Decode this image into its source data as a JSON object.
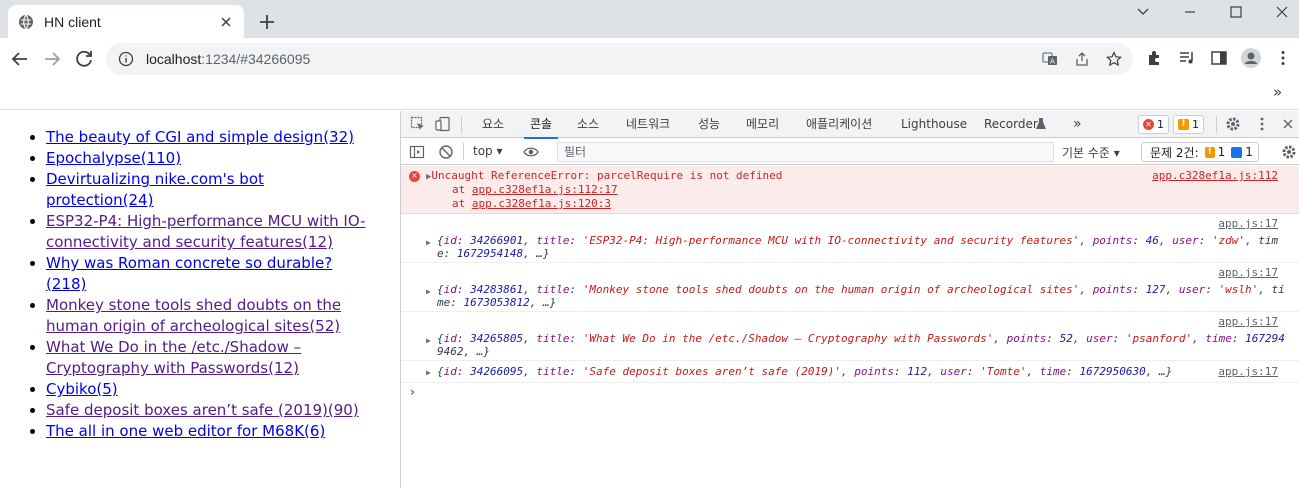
{
  "browser": {
    "tab_title": "HN client",
    "url_host": "localhost",
    "url_rest": ":1234/#34266095",
    "bookmark_more": "»"
  },
  "page": {
    "stories": [
      {
        "title": "The beauty of CGI and simple design",
        "count": "(32)",
        "visited": false
      },
      {
        "title": "Epochalypse",
        "count": "(110)",
        "visited": false
      },
      {
        "title": "Devirtualizing nike.com's bot protection",
        "count": "(24)",
        "visited": false
      },
      {
        "title": "ESP32-P4: High-performance MCU with IO-connectivity and security features",
        "count": "(12)",
        "visited": true
      },
      {
        "title": "Why was Roman concrete so durable?",
        "count": "(218)",
        "visited": false
      },
      {
        "title": "Monkey stone tools shed doubts on the human origin of archeological sites",
        "count": "(52)",
        "visited": true
      },
      {
        "title": "What We Do in the /etc./Shadow – Cryptography with Passwords",
        "count": "(12)",
        "visited": true
      },
      {
        "title": "Cybiko",
        "count": "(5)",
        "visited": false
      },
      {
        "title": "Safe deposit boxes aren’t safe (2019)",
        "count": "(90)",
        "visited": true
      },
      {
        "title": "The all in one web editor for M68K",
        "count": "(6)",
        "visited": false
      }
    ]
  },
  "devtools": {
    "tabs": [
      "요소",
      "콘솔",
      "소스",
      "네트워크",
      "성능",
      "메모리",
      "애플리케이션",
      "Lighthouse",
      "Recorder"
    ],
    "tabs_more": "»",
    "error_count": "1",
    "warning_count": "1",
    "context": "top",
    "filter_placeholder": "필터",
    "levels": "기본 수준",
    "issues_label": "문제 2건:",
    "issues_warn": "1",
    "issues_info": "1",
    "error": {
      "message": "Uncaught ReferenceError: parcelRequire is not defined",
      "source": "app.c328ef1a.js:112",
      "stack": [
        {
          "prefix": "at ",
          "link": "app.c328ef1a.js:112:17"
        },
        {
          "prefix": "at ",
          "link": "app.c328ef1a.js:120:3"
        }
      ]
    },
    "logs": [
      {
        "source": "app.js:17",
        "line1": "{id: 34266901, title: 'ESP32-P4: High-performance MCU with IO-connectivity and security features', points: 46, user: 'zdw', tim",
        "line2": "e: 1672954148, …}"
      },
      {
        "source": "app.js:17",
        "line1": "{id: 34283861, title: 'Monkey stone tools shed doubts on the human origin of archeological sites', points: 127, user: 'wslh', ti",
        "line2": "me: 1673053812, …}"
      },
      {
        "source": "app.js:17",
        "line1": "{id: 34265805, title: 'What We Do in the /etc./Shadow – Cryptography with Passwords', points: 52, user: 'psanford', time: 167294",
        "line2": "9462, …}"
      },
      {
        "source": "app.js:17",
        "line1": "{id: 34266095, title: 'Safe deposit boxes aren’t safe (2019)', points: 112, user: 'Tomte', time: 1672950630, …}",
        "line2": ""
      }
    ],
    "prompt": "›"
  }
}
